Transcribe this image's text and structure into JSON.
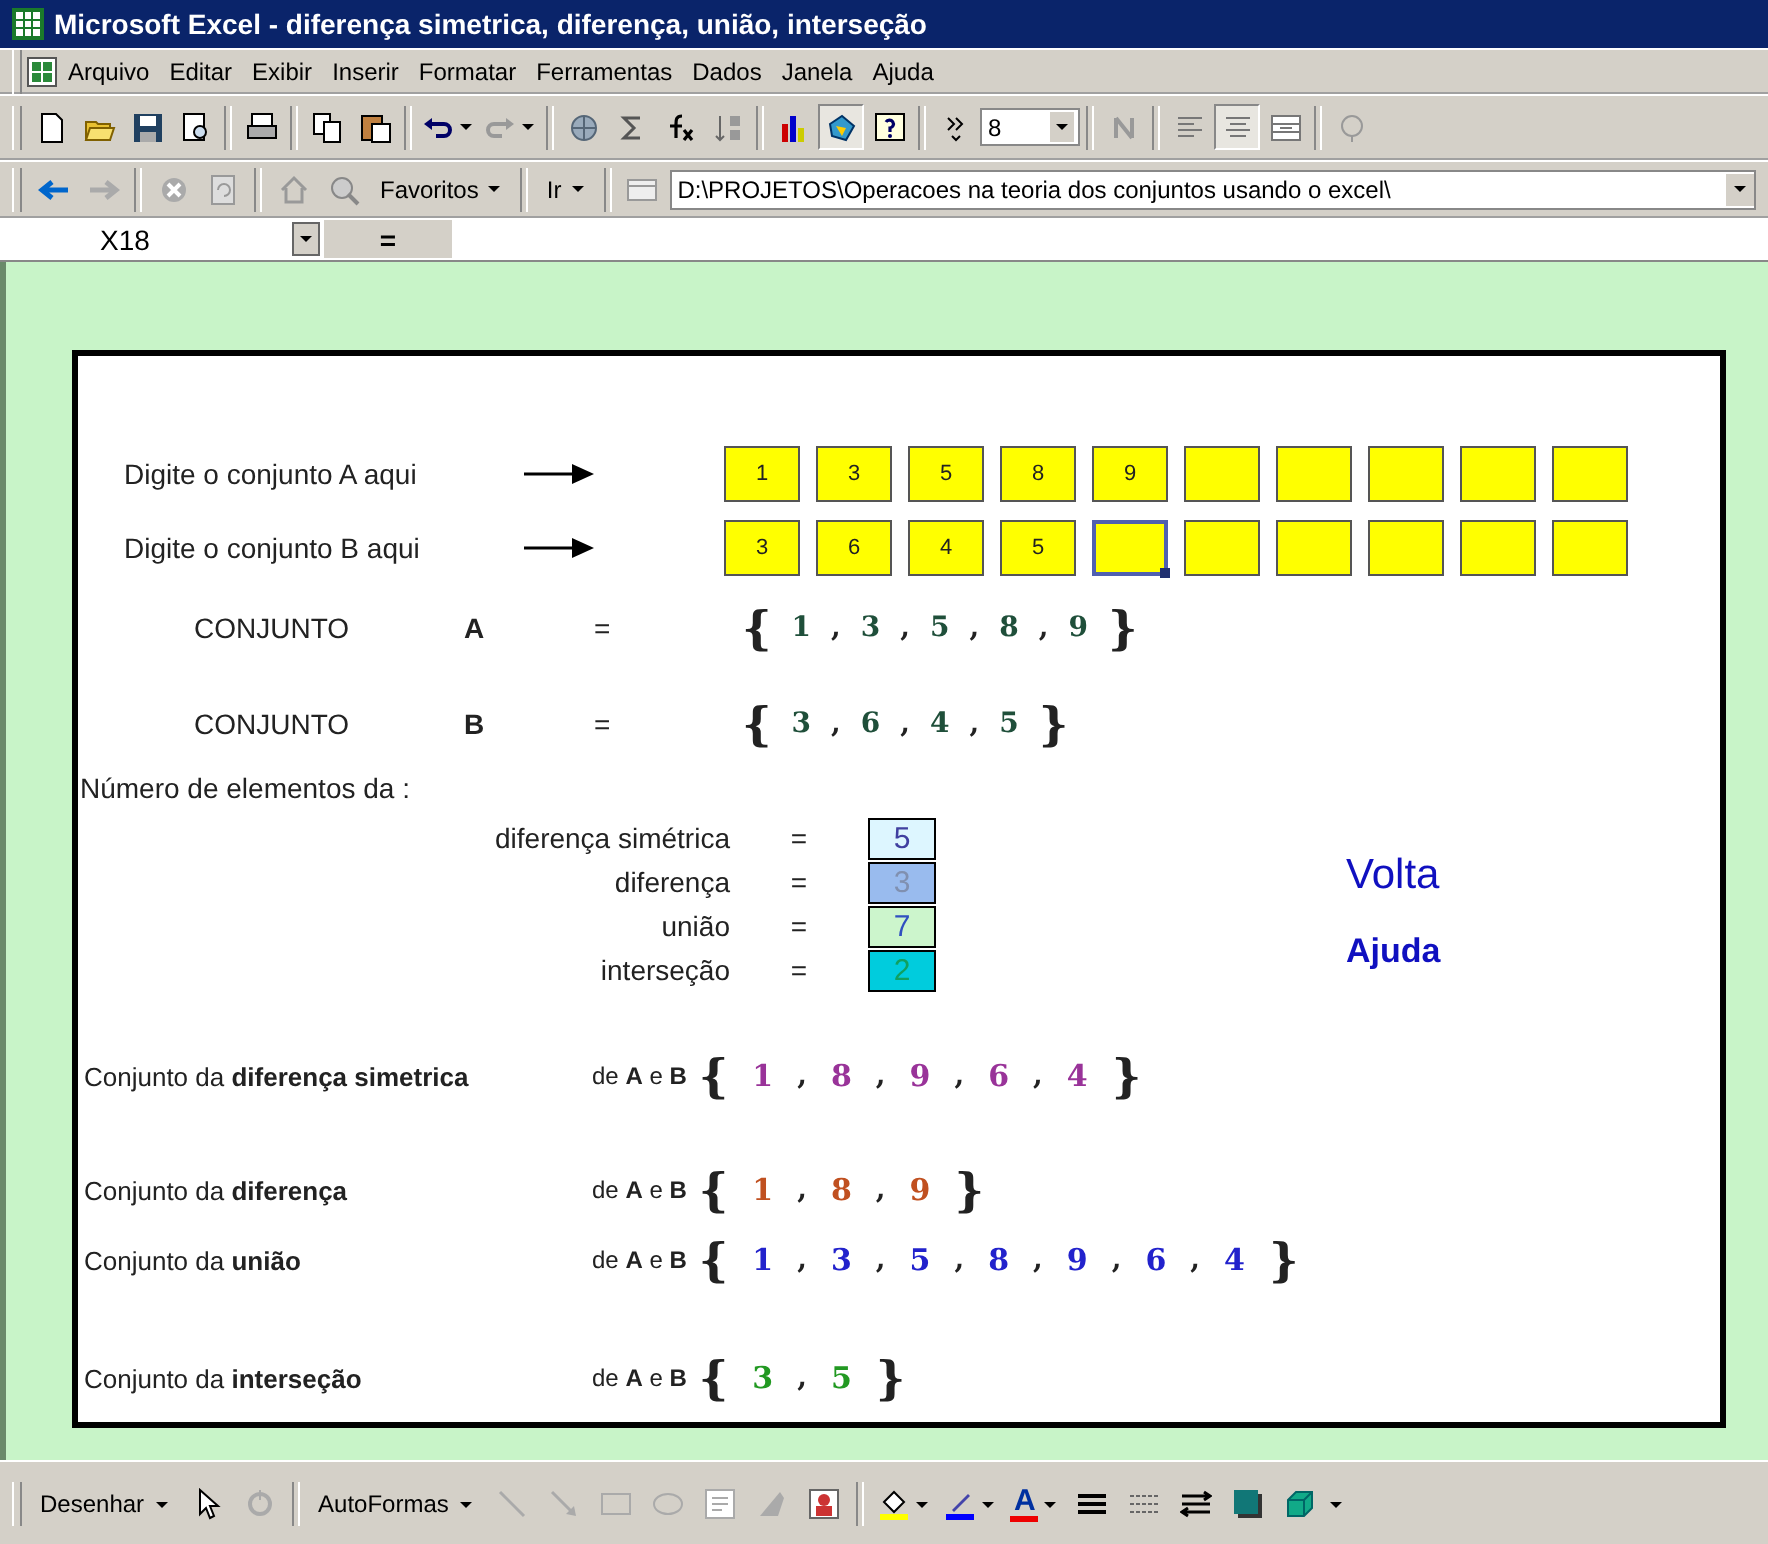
{
  "title_bar": {
    "title": "Microsoft Excel - diferença simetrica, diferença, união, interseção"
  },
  "menu_bar": {
    "items": [
      "Arquivo",
      "Editar",
      "Exibir",
      "Inserir",
      "Formatar",
      "Ferramentas",
      "Dados",
      "Janela",
      "Ajuda"
    ]
  },
  "standard_toolbar": {
    "font_size": "8"
  },
  "web_toolbar": {
    "favorites": "Favoritos",
    "go": "Ir",
    "address": "D:\\PROJETOS\\Operacoes na teoria dos conjuntos usando o excel\\"
  },
  "formula_bar": {
    "name_box": "X18",
    "equals": "="
  },
  "sheet": {
    "inputs": [
      {
        "label": "Digite o conjunto A aqui",
        "cells": [
          {
            "value": "1",
            "selected": false
          },
          {
            "value": "3",
            "selected": false
          },
          {
            "value": "5",
            "selected": false
          },
          {
            "value": "8",
            "selected": false
          },
          {
            "value": "9",
            "selected": false
          },
          {
            "selected": false
          },
          {
            "selected": false
          },
          {
            "selected": false
          },
          {
            "selected": false
          },
          {
            "selected": false
          }
        ]
      },
      {
        "label": "Digite o conjunto B aqui",
        "cells": [
          {
            "value": "3",
            "selected": false
          },
          {
            "value": "6",
            "selected": false
          },
          {
            "value": "4",
            "selected": false
          },
          {
            "value": "5",
            "selected": false
          },
          {
            "selected": true
          },
          {
            "selected": false
          },
          {
            "selected": false
          },
          {
            "selected": false
          },
          {
            "selected": false
          },
          {
            "selected": false
          }
        ]
      }
    ],
    "sets": [
      {
        "label": "CONJUNTO",
        "name": "A",
        "equals": "=",
        "open": "{",
        "close": "}",
        "separator": ",",
        "elements": [
          "1",
          "3",
          "5",
          "8",
          "9"
        ]
      },
      {
        "label": "CONJUNTO",
        "name": "B",
        "equals": "=",
        "open": "{",
        "close": "}",
        "separator": ",",
        "elements": [
          "3",
          "6",
          "4",
          "5"
        ]
      }
    ],
    "counts_heading": "Número de elementos da :",
    "counts": [
      {
        "label": "diferença simétrica",
        "equals": "=",
        "value": "5",
        "color": "#ddf6ff"
      },
      {
        "label": "diferença",
        "equals": "=",
        "value": "3",
        "color": "#99bbee"
      },
      {
        "label": "união",
        "equals": "=",
        "value": "7",
        "color": "#ccf5cc"
      },
      {
        "label": "interseção",
        "equals": "=",
        "value": "2",
        "color": "#00ccdd"
      }
    ],
    "links": [
      {
        "text": "Volta"
      },
      {
        "text": "Ajuda"
      }
    ],
    "results": [
      {
        "label": "Conjunto da **diferença simetrica**",
        "of": "de **A** e **B**",
        "open": "{",
        "close": "}",
        "separator": ",",
        "elements": [
          "1",
          "8",
          "9",
          "6",
          "4"
        ],
        "color": "#993399"
      },
      {
        "label": "Conjunto da **diferença**",
        "of": "de **A** e **B**",
        "open": "{",
        "close": "}",
        "separator": ",",
        "elements": [
          "1",
          "8",
          "9"
        ],
        "color": "#c05020"
      },
      {
        "label": "Conjunto da **união**",
        "of": "de **A** e **B**",
        "open": "{",
        "close": "}",
        "separator": ",",
        "elements": [
          "1",
          "3",
          "5",
          "8",
          "9",
          "6",
          "4"
        ],
        "color": "#2222cc"
      },
      {
        "label": "Conjunto da **interseção**",
        "of": "de **A** e **B**",
        "open": "{",
        "close": "}",
        "separator": ",",
        "elements": [
          "3",
          "5"
        ],
        "color": "#229922"
      }
    ]
  },
  "drawing_toolbar": {
    "draw": "Desenhar",
    "autoshapes": "AutoFormas",
    "font_color_glyph": "A"
  }
}
